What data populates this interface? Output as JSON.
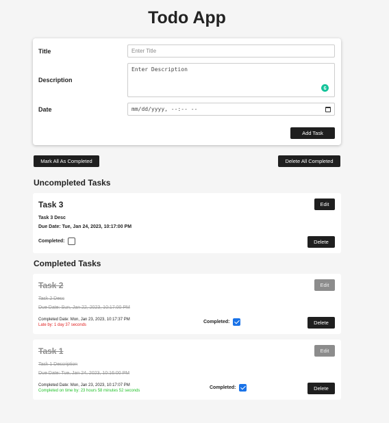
{
  "app": {
    "title": "Todo App"
  },
  "form": {
    "title_label": "Title",
    "title_placeholder": "Enter Title",
    "description_label": "Description",
    "description_placeholder": "Enter Description",
    "date_label": "Date",
    "date_placeholder": "mm/dd/yyyy, --:-- --",
    "add_button": "Add Task"
  },
  "actions": {
    "mark_all": "Mark All As Completed",
    "delete_all_completed": "Delete All Completed"
  },
  "uncompleted": {
    "heading": "Uncompleted Tasks",
    "tasks": [
      {
        "title": "Task 3",
        "description": "Task 3 Desc",
        "due": "Due Date: Tue, Jan 24, 2023, 10:17:00 PM",
        "completed_label": "Completed:",
        "completed": false,
        "edit": "Edit",
        "delete": "Delete"
      }
    ]
  },
  "completed": {
    "heading": "Completed Tasks",
    "tasks": [
      {
        "title": "Task 2",
        "description": "Task 2 Desc",
        "due": "Due Date: Sun, Jan 22, 2023, 10:17:00 PM",
        "completed_date": "Completed Date: Mon, Jan 23, 2023, 10:17:37 PM",
        "status": "Late by: 1 day 37 seconds",
        "status_color": "#e02020",
        "completed_label": "Completed:",
        "completed": true,
        "edit": "Edit",
        "delete": "Delete"
      },
      {
        "title": "Task 1",
        "description": "Task 1 Description",
        "due": "Due Date: Tue, Jan 24, 2023, 10:16:00 PM",
        "completed_date": "Completed Date: Mon, Jan 23, 2023, 10:17:07 PM",
        "status": "Completed on time by: 23 hours 58 minutes 52 seconds",
        "status_color": "#22c12a",
        "completed_label": "Completed:",
        "completed": true,
        "edit": "Edit",
        "delete": "Delete"
      }
    ]
  },
  "colors": {
    "background": "#f5f5f5",
    "button": "#1f1f1f",
    "button_disabled": "#8c8c8c",
    "checkbox_checked": "#1a73e8",
    "grammarly": "#15c39a"
  },
  "icons": [
    "grammarly-icon",
    "calendar-icon",
    "checkbox-icon"
  ]
}
